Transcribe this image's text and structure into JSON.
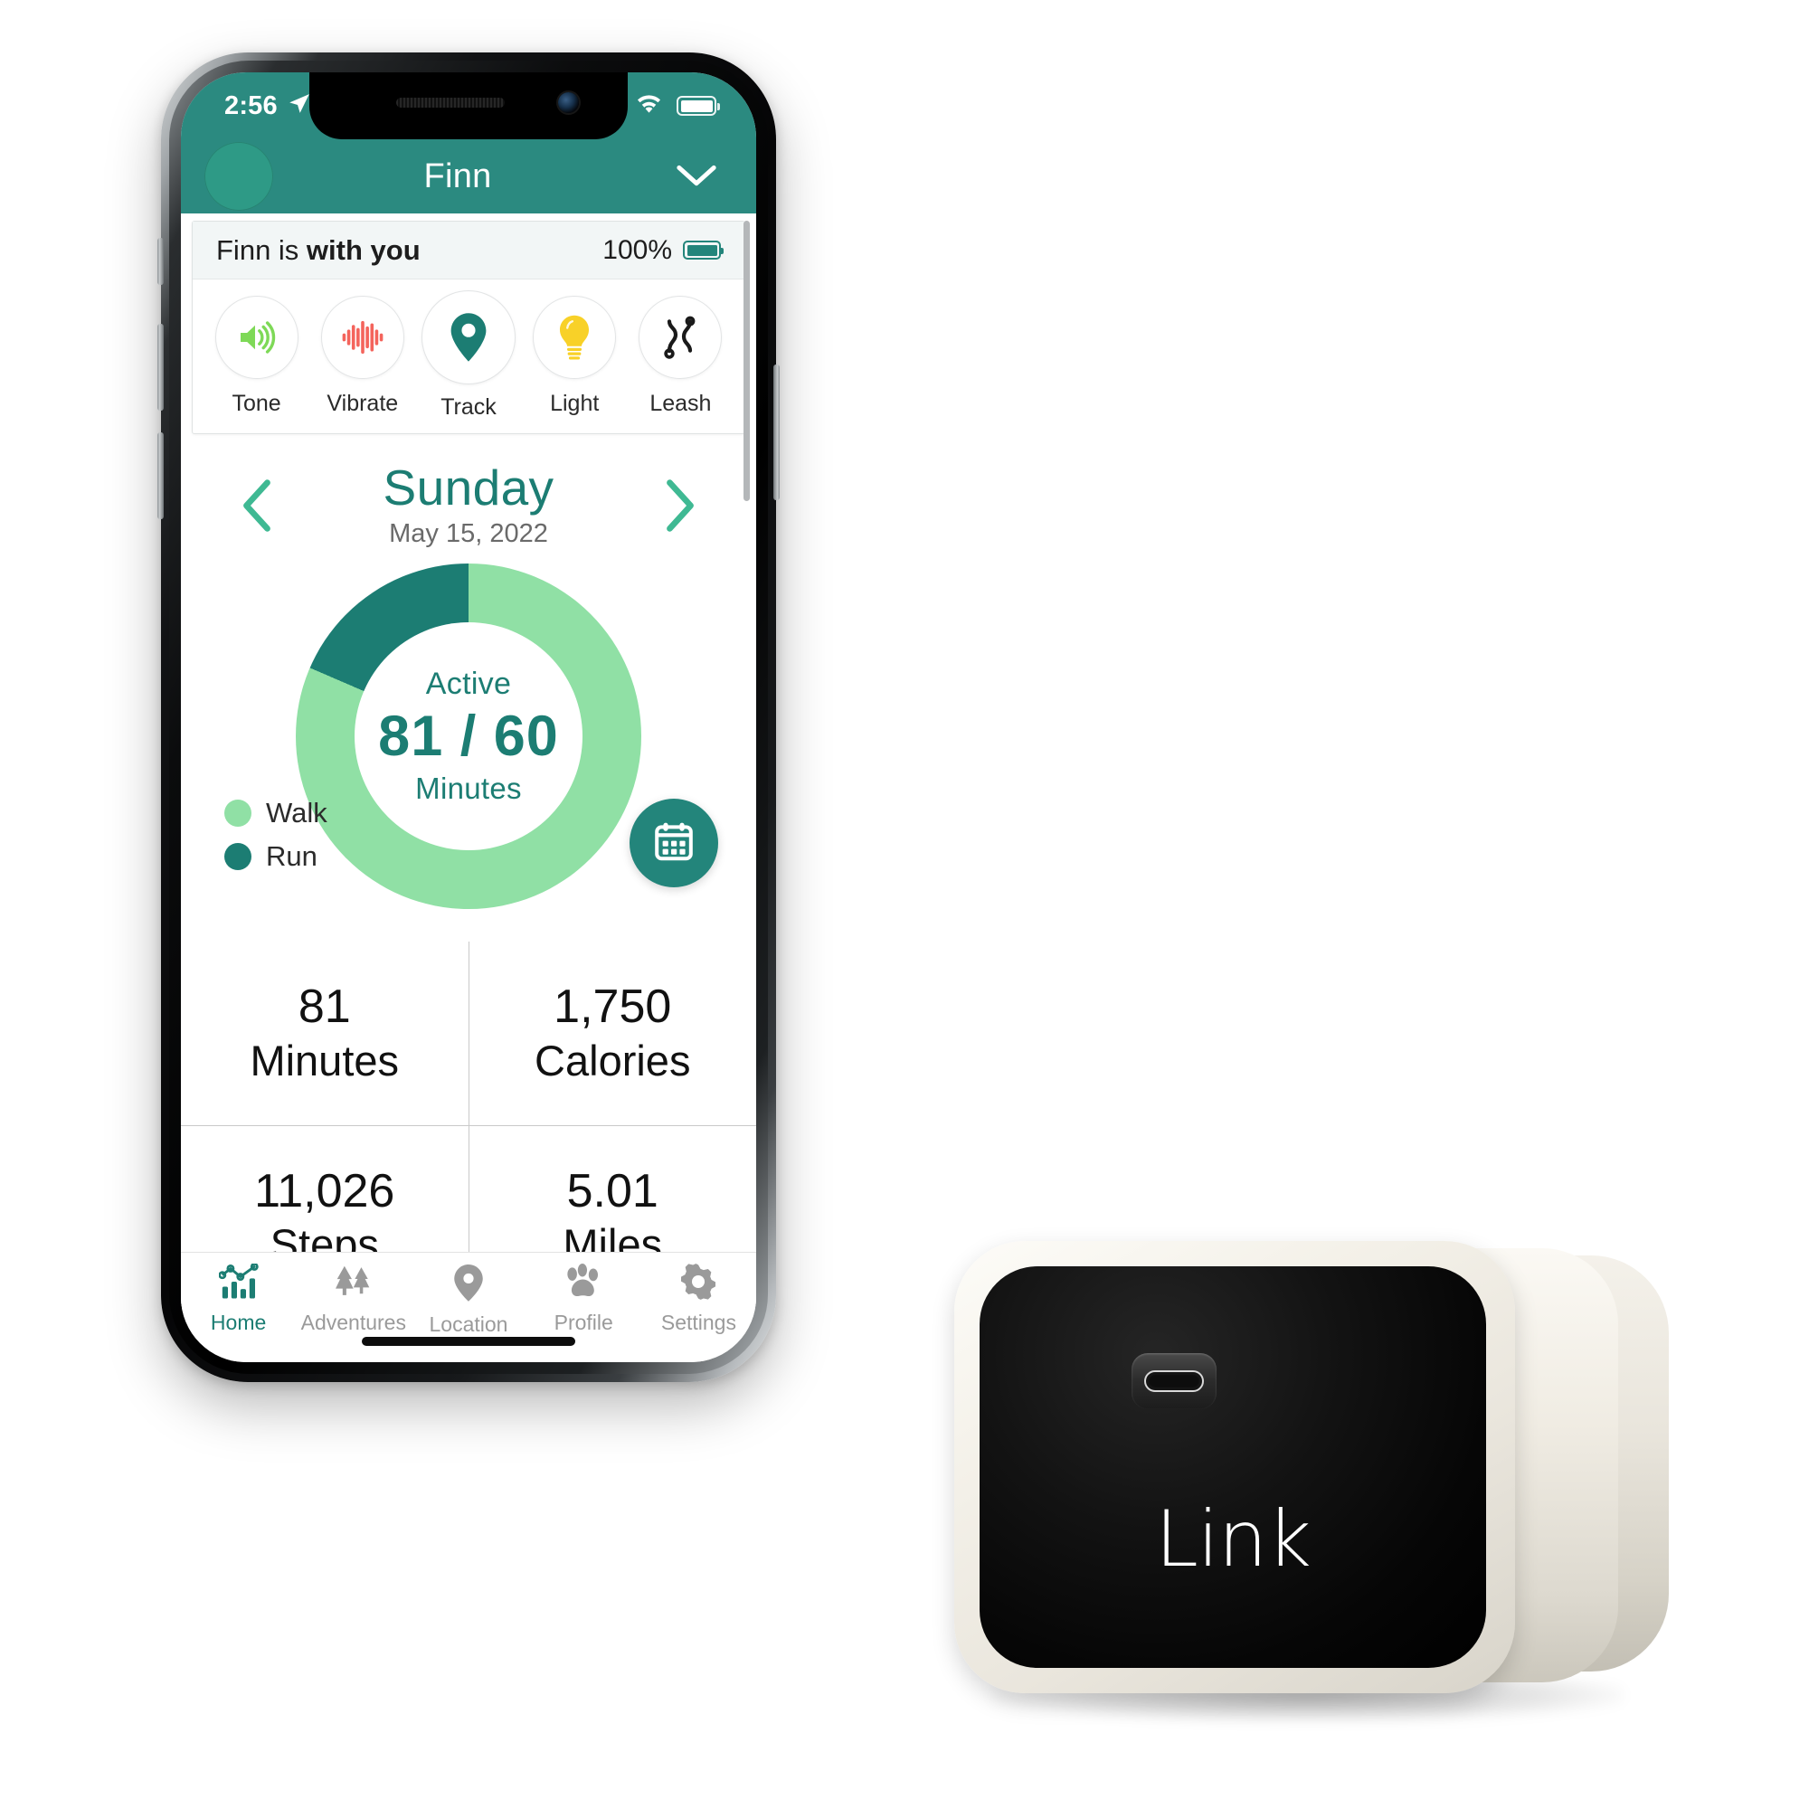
{
  "status_bar": {
    "time": "2:56",
    "location_icon": "location-arrow-icon",
    "wifi_icon": "wifi-icon",
    "battery_icon": "battery-full-icon"
  },
  "header": {
    "avatar": "dog-avatar",
    "title": "Finn",
    "chevron_icon": "chevron-down-icon"
  },
  "device_card": {
    "status_prefix": "Finn is ",
    "status_emphasis": "with you",
    "battery_percent": "100%",
    "battery_icon": "battery-full-icon",
    "actions": [
      {
        "label": "Tone",
        "icon": "speaker-volume-icon"
      },
      {
        "label": "Vibrate",
        "icon": "waveform-icon"
      },
      {
        "label": "Track",
        "icon": "map-pin-icon"
      },
      {
        "label": "Light",
        "icon": "lightbulb-icon"
      },
      {
        "label": "Leash",
        "icon": "leash-icon"
      }
    ]
  },
  "date_nav": {
    "prev_icon": "chevron-left-icon",
    "next_icon": "chevron-right-icon",
    "weekday": "Sunday",
    "date": "May 15, 2022"
  },
  "activity": {
    "center_title": "Active",
    "center_value": "81 / 60",
    "center_unit": "Minutes",
    "calendar_icon": "calendar-icon"
  },
  "stats": {
    "rows": [
      [
        {
          "value": "81",
          "label": "Minutes"
        },
        {
          "value": "1,750",
          "label": "Calories"
        }
      ],
      [
        {
          "value": "11,026",
          "label": "Steps"
        },
        {
          "value": "5.01",
          "label": "Miles"
        }
      ]
    ]
  },
  "tab_bar": {
    "tabs": [
      {
        "label": "Home",
        "icon": "chart-bars-icon",
        "active": true
      },
      {
        "label": "Adventures",
        "icon": "trees-icon",
        "active": false
      },
      {
        "label": "Location",
        "icon": "map-pin-icon",
        "active": false
      },
      {
        "label": "Profile",
        "icon": "paw-print-icon",
        "active": false
      },
      {
        "label": "Settings",
        "icon": "gear-icon",
        "active": false
      }
    ]
  },
  "link_device": {
    "wordmark": "Link",
    "usb_port_icon": "usb-c-port-icon"
  },
  "chart_data": {
    "type": "pie",
    "title": "Active Minutes",
    "subtitle": "Sunday, May 15, 2022",
    "total_label": "81 / 60 Minutes",
    "goal": 60,
    "achieved": 81,
    "categories": [
      "Walk",
      "Run"
    ],
    "values": [
      66,
      15
    ],
    "unit": "minutes",
    "colors": [
      "#90e0a5",
      "#1c7d73"
    ],
    "legend_position": "left",
    "donut": true,
    "grid": false
  },
  "colors": {
    "brand_teal": "#2b8a80",
    "dark_teal": "#1c7d73",
    "walk_green": "#90e0a5",
    "run_teal": "#1c7d73",
    "tone_green": "#7ed957",
    "vibrate_red": "#f4645c",
    "light_yellow": "#f8d128",
    "inactive_gray": "#9a9a9a"
  }
}
